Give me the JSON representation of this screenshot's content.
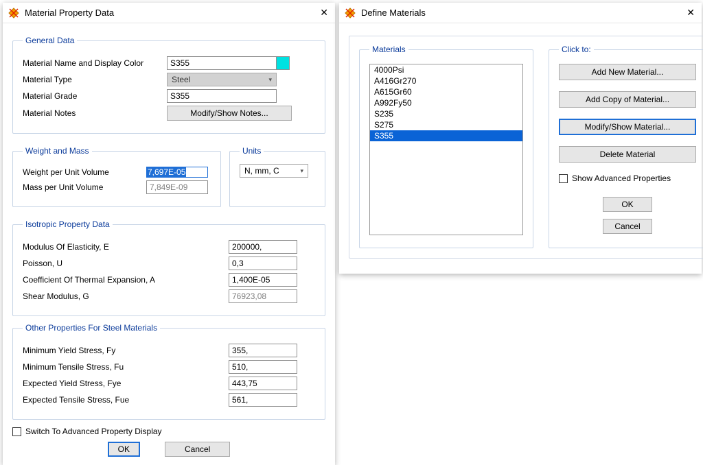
{
  "material_dialog": {
    "title": "Material Property Data",
    "groups": {
      "general": {
        "legend": "General Data",
        "name_label": "Material Name and Display Color",
        "name_value": "S355",
        "type_label": "Material Type",
        "type_value": "Steel",
        "grade_label": "Material Grade",
        "grade_value": "S355",
        "notes_label": "Material Notes",
        "notes_button": "Modify/Show Notes..."
      },
      "weight": {
        "legend": "Weight and Mass",
        "wpuv_label": "Weight per Unit Volume",
        "wpuv_value": "7,697E-05",
        "mpuv_label": "Mass per Unit Volume",
        "mpuv_value": "7,849E-09"
      },
      "units": {
        "legend": "Units",
        "value": "N, mm, C"
      },
      "iso": {
        "legend": "Isotropic Property Data",
        "e_label": "Modulus Of Elasticity,  E",
        "e_value": "200000,",
        "u_label": "Poisson, U",
        "u_value": "0,3",
        "a_label": "Coefficient Of Thermal Expansion,  A",
        "a_value": "1,400E-05",
        "g_label": "Shear Modulus,  G",
        "g_value": "76923,08"
      },
      "steel": {
        "legend": "Other Properties For Steel Materials",
        "fy_label": "Minimum Yield Stress, Fy",
        "fy_value": "355,",
        "fu_label": "Minimum Tensile Stress, Fu",
        "fu_value": "510,",
        "fye_label": "Expected Yield Stress, Fye",
        "fye_value": "443,75",
        "fue_label": "Expected Tensile Stress, Fue",
        "fue_value": "561,"
      }
    },
    "advanced_toggle": "Switch To Advanced Property Display",
    "ok": "OK",
    "cancel": "Cancel"
  },
  "define_dialog": {
    "title": "Define Materials",
    "materials_legend": "Materials",
    "materials": [
      "4000Psi",
      "A416Gr270",
      "A615Gr60",
      "A992Fy50",
      "S235",
      "S275",
      "S355"
    ],
    "selected_index": 6,
    "clickto_legend": "Click to:",
    "add_new": "Add New Material...",
    "add_copy": "Add Copy of Material...",
    "modify": "Modify/Show Material...",
    "delete": "Delete Material",
    "show_adv": "Show Advanced Properties",
    "ok": "OK",
    "cancel": "Cancel"
  },
  "colors": {
    "accent": "#0a3a9a",
    "swatch": "#00e1e1",
    "selection": "#0a63d6"
  }
}
